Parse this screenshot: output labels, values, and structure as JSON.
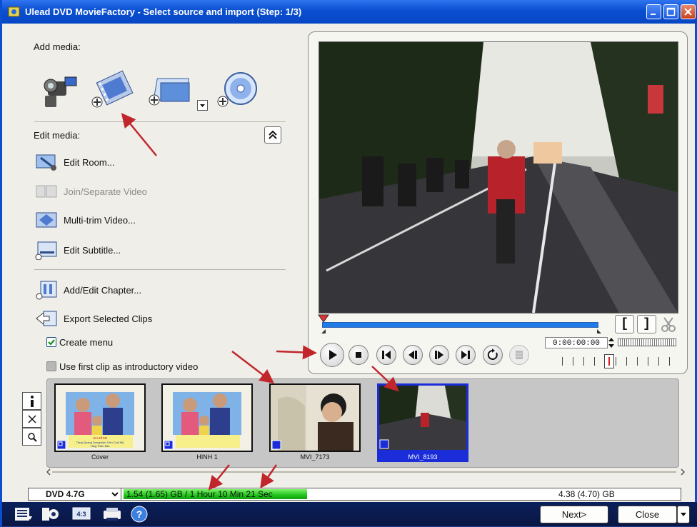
{
  "window": {
    "title": "Ulead DVD MovieFactory - Select source and import (Step: 1/3)"
  },
  "add_media": {
    "label": "Add media:",
    "icons": [
      "camcorder-icon",
      "add-video-icon",
      "add-image-icon",
      "add-disc-icon"
    ]
  },
  "edit_media": {
    "label": "Edit media:",
    "items": [
      {
        "label": "Edit Room...",
        "enabled": true
      },
      {
        "label": "Join/Separate Video",
        "enabled": false
      },
      {
        "label": "Multi-trim Video...",
        "enabled": true
      },
      {
        "label": "Edit Subtitle...",
        "enabled": true
      }
    ]
  },
  "chapter": {
    "add_edit": "Add/Edit Chapter...",
    "export": "Export Selected Clips"
  },
  "options": {
    "create_menu": {
      "label": "Create menu",
      "checked": true
    },
    "first_clip": {
      "label": "Use first clip as introductory video",
      "checked": false
    }
  },
  "player": {
    "timecode": "0:00:00:00",
    "in_bracket": "[",
    "out_bracket": "]"
  },
  "clips": [
    {
      "caption": "Cover",
      "selected": false
    },
    {
      "caption": "HINH 1",
      "selected": false
    },
    {
      "caption": "MVI_7173",
      "selected": false
    },
    {
      "caption": "MVI_8193",
      "selected": true
    }
  ],
  "clip_overlay": {
    "line1": "GIA ĐÌNH",
    "line2": "Tăng Quang Dongnhan Trên Cuối Mỹ",
    "line3": "Tăng Thiên Bảo"
  },
  "side_tools": [
    "info-icon",
    "delete-icon",
    "zoom-icon"
  ],
  "disc": {
    "type": "DVD 4.7G",
    "usage_text": "1.54 (1.65) GB / 1 Hour 10 Min 21 Sec",
    "usage_fraction": 0.33,
    "capacity": "4.38 (4.70) GB"
  },
  "footer": {
    "next": "Next>",
    "close": "Close",
    "aspect_label": "4:3"
  },
  "colors": {
    "titlebar": "#0a4fd0",
    "selection": "#1a2dd8",
    "usage": "#21c41b",
    "annotation_arrow": "#c0262c"
  }
}
